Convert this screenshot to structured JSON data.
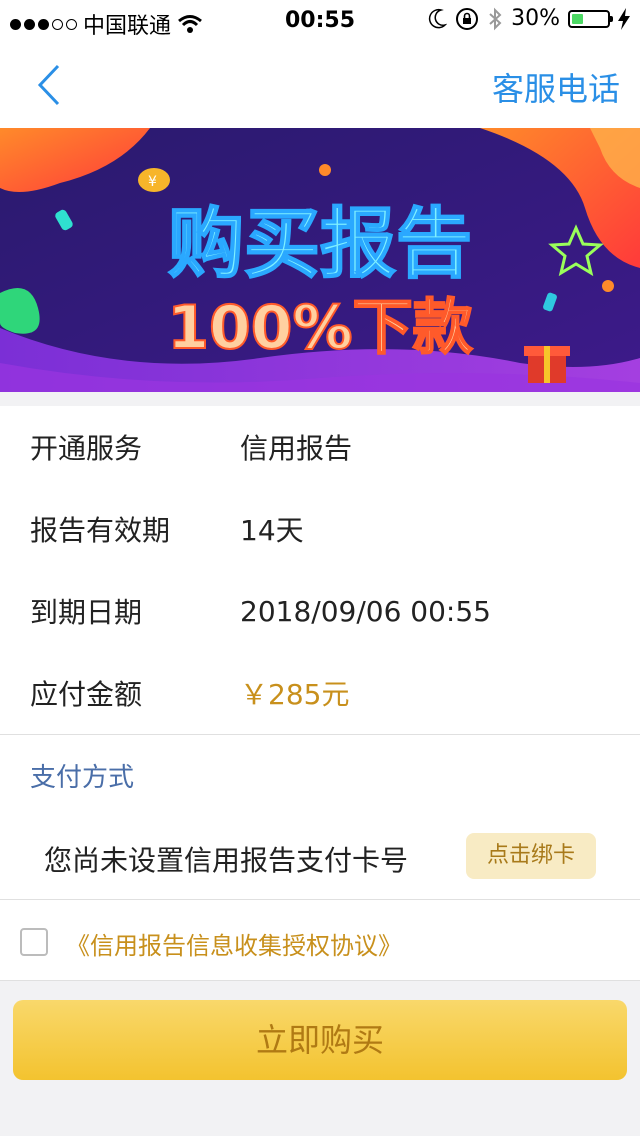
{
  "status_bar": {
    "carrier": "中国联通",
    "time": "00:55",
    "battery_percent": "30%",
    "battery_level": 0.3
  },
  "nav": {
    "right_label": "客服电话"
  },
  "banner": {
    "title": "购买报告",
    "subtitle": "100%下款"
  },
  "info": {
    "rows": [
      {
        "label": "开通服务",
        "value": "信用报告"
      },
      {
        "label": "报告有效期",
        "value": "14天"
      },
      {
        "label": "到期日期",
        "value": "2018/09/06 00:55"
      },
      {
        "label": "应付金额",
        "value": "￥285元"
      }
    ]
  },
  "payment": {
    "title": "支付方式",
    "message": "您尚未设置信用报告支付卡号",
    "bind_label": "点击绑卡"
  },
  "agreement": {
    "link_text": "《信用报告信息收集授权协议》",
    "checked": false
  },
  "buy_button": {
    "label": "立即购买"
  },
  "colors": {
    "accent_blue": "#2a8fe6",
    "price_gold": "#c8901c",
    "button_yellow": "#f3c32f"
  }
}
